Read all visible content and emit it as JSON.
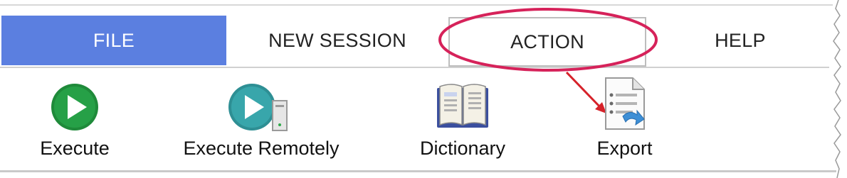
{
  "menu": {
    "tabs": [
      {
        "label": "FILE"
      },
      {
        "label": "NEW SESSION"
      },
      {
        "label": "ACTION"
      },
      {
        "label": "HELP"
      }
    ]
  },
  "toolbar": {
    "items": [
      {
        "label": "Execute",
        "icon": "play-icon"
      },
      {
        "label": "Execute Remotely",
        "icon": "remote-play-icon"
      },
      {
        "label": "Dictionary",
        "icon": "book-icon"
      },
      {
        "label": "Export",
        "icon": "export-document-icon"
      }
    ]
  },
  "colors": {
    "file_tab": "#5b7fe0",
    "highlight": "#d6225a",
    "execute_green": "#1f8a3a",
    "remote_teal": "#2e8f94"
  }
}
